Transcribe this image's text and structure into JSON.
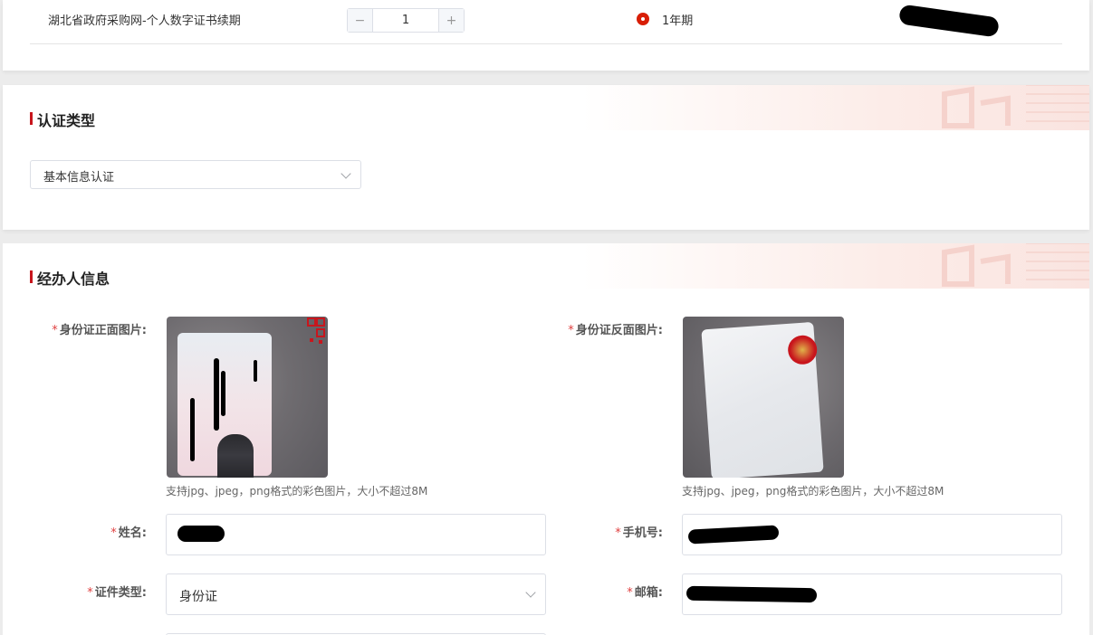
{
  "order": {
    "product_name": "湖北省政府采购网-个人数字证书续期",
    "quantity": "1",
    "decrement_symbol": "−",
    "increment_symbol": "+",
    "period_label": "1年期"
  },
  "auth_section": {
    "title": "认证类型",
    "select_value": "基本信息认证"
  },
  "agent_section": {
    "title": "经办人信息",
    "required_mark": "*",
    "id_front_label": "身份证正面图片:",
    "id_back_label": "身份证反面图片:",
    "upload_hint": "支持jpg、jpeg，png格式的彩色图片，大小不超过8M",
    "name_label": "姓名:",
    "phone_label": "手机号:",
    "id_type_label": "证件类型:",
    "id_type_value": "身份证",
    "email_label": "邮箱:",
    "icons": [
      "chevron-down-icon",
      "qr-code-icon"
    ],
    "colors": {
      "accent": "#c8161d",
      "required": "#e04040"
    }
  }
}
